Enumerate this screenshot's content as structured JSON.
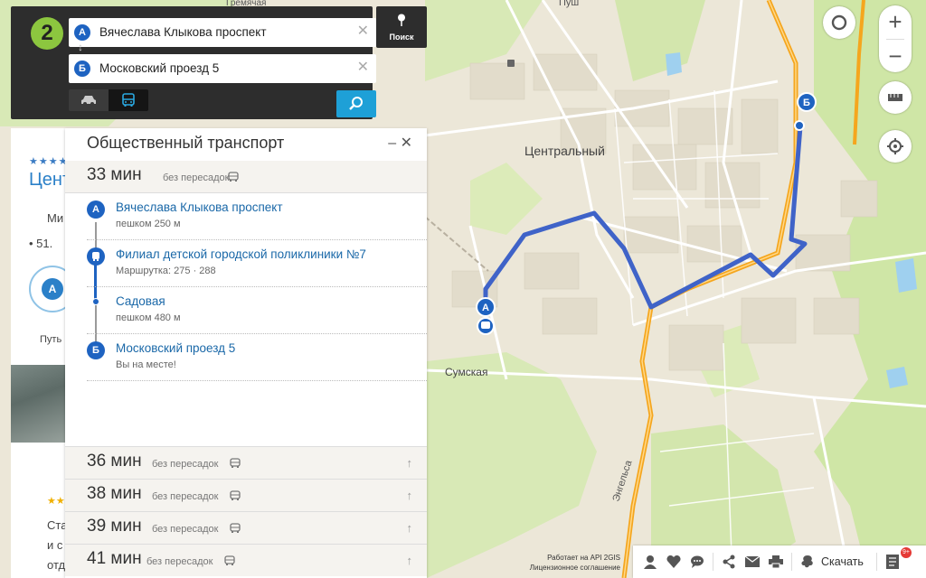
{
  "search": {
    "from_letter": "А",
    "to_letter": "Б",
    "from_value": "Вячеслава Клыкова проспект",
    "to_value": "Московский проезд 5",
    "search_button_label": "Поиск",
    "logo_text": "2",
    "clear_glyph": "✕",
    "swap_glyph": "↕"
  },
  "transit": {
    "title": "Общественный транспорт",
    "window_controls": "– ✕",
    "main_option": {
      "time": "33 мин",
      "note": "без пересадок"
    },
    "steps": [
      {
        "letter": "А",
        "name": "Вячеслава Клыкова проспект",
        "sub": "пешком 250 м"
      },
      {
        "letter": "",
        "name": "Филиал детской городской поликлиники №7",
        "sub": "Маршрутка: 275 · 288"
      },
      {
        "letter": "",
        "name": "Садовая",
        "sub": "пешком 480 м"
      },
      {
        "letter": "Б",
        "name": "Московский проезд 5",
        "sub": "Вы на месте!"
      }
    ],
    "alternatives": [
      {
        "time": "36 мин",
        "note": "без пересадок"
      },
      {
        "time": "38 мин",
        "note": "без пересадок"
      },
      {
        "time": "39 мин",
        "note": "без пересадок"
      },
      {
        "time": "41 мин",
        "note": "без пересадок"
      }
    ]
  },
  "underlying_card": {
    "stars": "★★★★",
    "title": "Цент",
    "line1": "Ми",
    "line2": "• 51.",
    "line3": "Путь",
    "stars2": "★★",
    "text1": "Ста",
    "text2": "и с",
    "text3": "отд"
  },
  "map": {
    "labels": {
      "central": "Центральный",
      "sumskaya": "Сумская",
      "engelsa": "Энгельса",
      "top_street": "Пуш",
      "top_street2": "Гремячая"
    },
    "route_color": "#3f63c8",
    "marker_a": "А",
    "marker_b": "Б"
  },
  "controls": {
    "zoom_in": "+",
    "zoom_out": "−"
  },
  "bottombar": {
    "download_label": "Скачать",
    "notif_count": "9+",
    "credits_line1": "Работает на API 2GIS",
    "credits_line2": "Лицензионное соглашение"
  }
}
